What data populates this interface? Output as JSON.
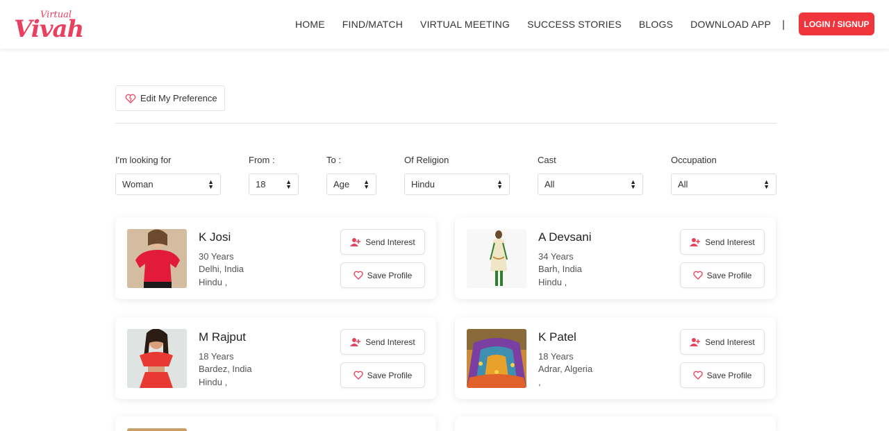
{
  "brand": {
    "logo_small": "Virtual",
    "logo_big": "Vivah",
    "accent": "#f0353c",
    "pink": "#e8415f"
  },
  "nav": {
    "items": [
      "HOME",
      "FIND/MATCH",
      "VIRTUAL MEETING",
      "SUCCESS STORIES",
      "BLOGS",
      "DOWNLOAD APP"
    ],
    "separator": "|",
    "login_label": "LOGIN / SIGNUP"
  },
  "preference": {
    "label": "Edit My Preference",
    "icon": "heart-icon"
  },
  "filters": [
    {
      "label": "I'm looking for",
      "value": "Woman"
    },
    {
      "label": "From :",
      "value": "18"
    },
    {
      "label": "To :",
      "value": "Age"
    },
    {
      "label": "Of Religion",
      "value": "Hindu"
    },
    {
      "label": "Cast",
      "value": "All"
    },
    {
      "label": "Occupation",
      "value": "All"
    }
  ],
  "actions": {
    "send_interest": "Send Interest",
    "save_profile": "Save Profile"
  },
  "profiles": [
    {
      "name": "K Josi",
      "age": "30 Years",
      "location": "Delhi, India",
      "religion": "Hindu ,"
    },
    {
      "name": "A Devsani",
      "age": "34 Years",
      "location": "Barh, India",
      "religion": "Hindu ,"
    },
    {
      "name": "M Rajput",
      "age": "18 Years",
      "location": "Bardez, India",
      "religion": "Hindu ,"
    },
    {
      "name": "K Patel",
      "age": "18 Years",
      "location": "Adrar, Algeria",
      "religion": ","
    }
  ]
}
